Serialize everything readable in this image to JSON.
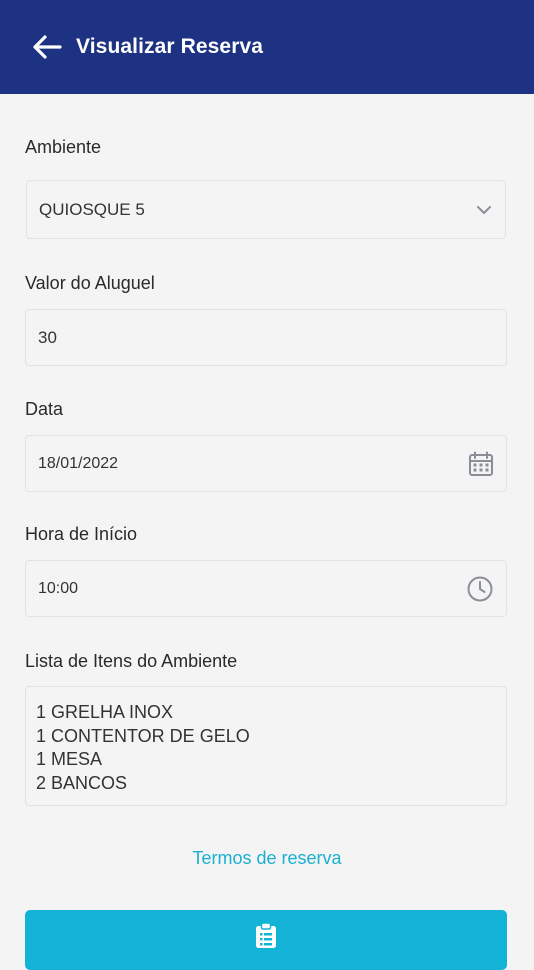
{
  "header": {
    "title": "Visualizar Reserva",
    "background": "#1d3282"
  },
  "form": {
    "ambiente": {
      "label": "Ambiente",
      "value": "QUIOSQUE 5"
    },
    "valor": {
      "label": "Valor do Aluguel",
      "value": "30"
    },
    "data": {
      "label": "Data",
      "value": "18/01/2022"
    },
    "hora": {
      "label": "Hora de Início",
      "value": "10:00"
    },
    "itens": {
      "label": "Lista de Itens do Ambiente",
      "lines": [
        "1 GRELHA INOX",
        "1 CONTENTOR DE GELO",
        "1 MESA",
        "2 BANCOS"
      ]
    }
  },
  "terms_link": "Termos de reserva",
  "colors": {
    "accent": "#12b3d6",
    "link": "#1ab0d0"
  },
  "icons": {
    "back": "arrow-left-icon",
    "dropdown": "chevron-down-icon",
    "date": "calendar-icon",
    "time": "clock-icon",
    "action": "clipboard-list-icon"
  }
}
